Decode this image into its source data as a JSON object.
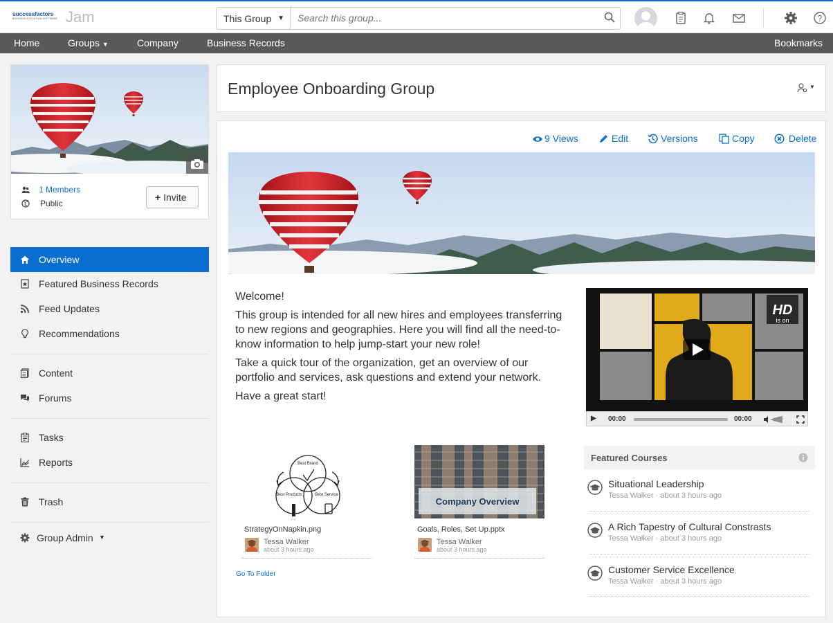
{
  "brand": {
    "logo_line1": "successfactors",
    "logo_line2": "BUSINESS EXECUTION SOFTWARE",
    "app_name": "Jam"
  },
  "search": {
    "scope": "This Group",
    "placeholder": "Search this group..."
  },
  "nav": {
    "home": "Home",
    "groups": "Groups",
    "company": "Company",
    "business_records": "Business Records",
    "bookmarks": "Bookmarks"
  },
  "group_card": {
    "members": "1 Members",
    "visibility": "Public",
    "invite": "Invite"
  },
  "sidebar": {
    "items": [
      {
        "label": "Overview",
        "icon": "home-icon"
      },
      {
        "label": "Featured Business Records",
        "icon": "star-doc-icon"
      },
      {
        "label": "Feed Updates",
        "icon": "rss-icon"
      },
      {
        "label": "Recommendations",
        "icon": "lightbulb-icon"
      },
      {
        "label": "Content",
        "icon": "documents-icon"
      },
      {
        "label": "Forums",
        "icon": "forum-icon"
      },
      {
        "label": "Tasks",
        "icon": "clipboard-icon"
      },
      {
        "label": "Reports",
        "icon": "chart-icon"
      },
      {
        "label": "Trash",
        "icon": "trash-icon"
      }
    ],
    "group_admin": "Group Admin"
  },
  "page": {
    "title": "Employee Onboarding Group"
  },
  "actions": {
    "views": "9 Views",
    "edit": "Edit",
    "versions": "Versions",
    "copy": "Copy",
    "delete": "Delete"
  },
  "welcome": {
    "heading": "Welcome!",
    "p1": "This group is intended for all new hires and employees transferring to new regions and geographies. Here you will find all the need-to-know information to help jump-start your new role!",
    "p2": "Take a quick tour of the organization, get an overview of our portfolio and services, ask questions and extend your network.",
    "p3": "Have a great start!"
  },
  "video": {
    "hd": "HD",
    "hd_sub": "is on",
    "time_current": "00:00",
    "time_total": "00:00"
  },
  "documents": [
    {
      "name": "StrategyOnNapkin.png",
      "owner": "Tessa Walker",
      "ago": "about 3 hours ago",
      "labels": [
        "Best Brand",
        "Best Products",
        "Best Service"
      ]
    },
    {
      "name": "Goals, Roles, Set Up.pptx",
      "owner": "Tessa Walker",
      "ago": "about 3 hours ago",
      "overlay": "Company Overview"
    }
  ],
  "goto_folder": "Go To Folder",
  "featured": {
    "heading": "Featured Courses",
    "courses": [
      {
        "title": "Situational Leadership",
        "owner": "Tessa Walker",
        "ago": "about 3 hours ago"
      },
      {
        "title": "A Rich Tapestry of Cultural Constrasts",
        "owner": "Tessa Walker",
        "ago": "about 3 hours ago"
      },
      {
        "title": "Customer Service Excellence",
        "owner": "Tessa Walker",
        "ago": "about 3 hours ago"
      }
    ]
  },
  "colors": {
    "accent": "#0a6ed1",
    "navbar": "#595959",
    "balloon": "#d8282f"
  }
}
